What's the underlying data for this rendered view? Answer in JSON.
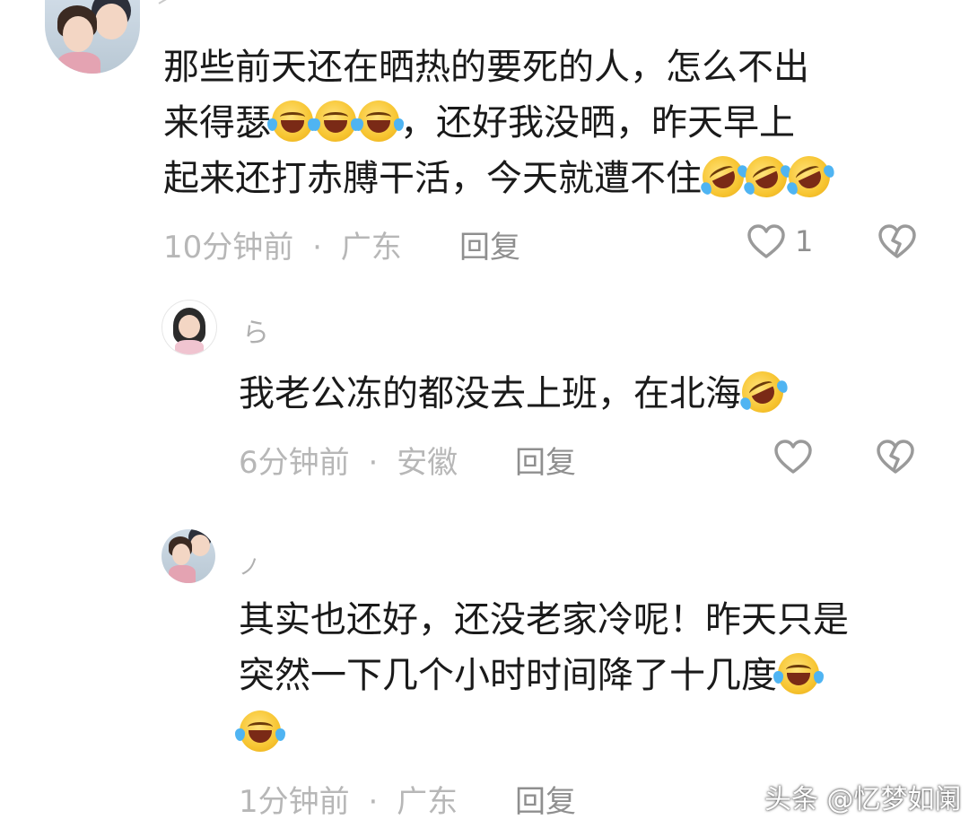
{
  "comments": [
    {
      "text": "那些前天还在晒热的要死的人，怎么不出来得瑟😂😂😂，还好我没晒，昨天早上起来还打赤膊干活，今天就遭不住🤣🤣🤣",
      "line1": "那些前天还在晒热的要死的人，怎么不出",
      "line2a": "来得瑟",
      "line2b": "，还好我没晒，昨天早上",
      "line3a": "起来还打赤膊干活，今天就遭不住",
      "time": "10分钟前",
      "location": "广东",
      "reply_label": "回复",
      "like_count": "1"
    },
    {
      "name_stub": "ら",
      "text": "我老公冻的都没去上班，在北海🤣",
      "line1a": "我老公冻的都没去上班，在北海",
      "time": "6分钟前",
      "location": "安徽",
      "reply_label": "回复"
    },
    {
      "name_stub": "ノ",
      "text": "其实也还好，还没老家冷呢！昨天只是突然一下几个小时时间降了十几度😂😂",
      "line1": "其实也还好，还没老家冷呢！昨天只是",
      "line2a": "突然一下几个小时时间降了十几度",
      "time": "1分钟前",
      "location": "广东",
      "reply_label": "回复"
    }
  ],
  "separator": "·",
  "watermark": "头条 @忆梦如阑",
  "icons": {
    "like": "heart-outline-icon",
    "dislike": "broken-heart-icon",
    "emoji_a": "face-with-tears-of-joy-emoji",
    "emoji_b": "rolling-on-floor-laughing-emoji"
  }
}
